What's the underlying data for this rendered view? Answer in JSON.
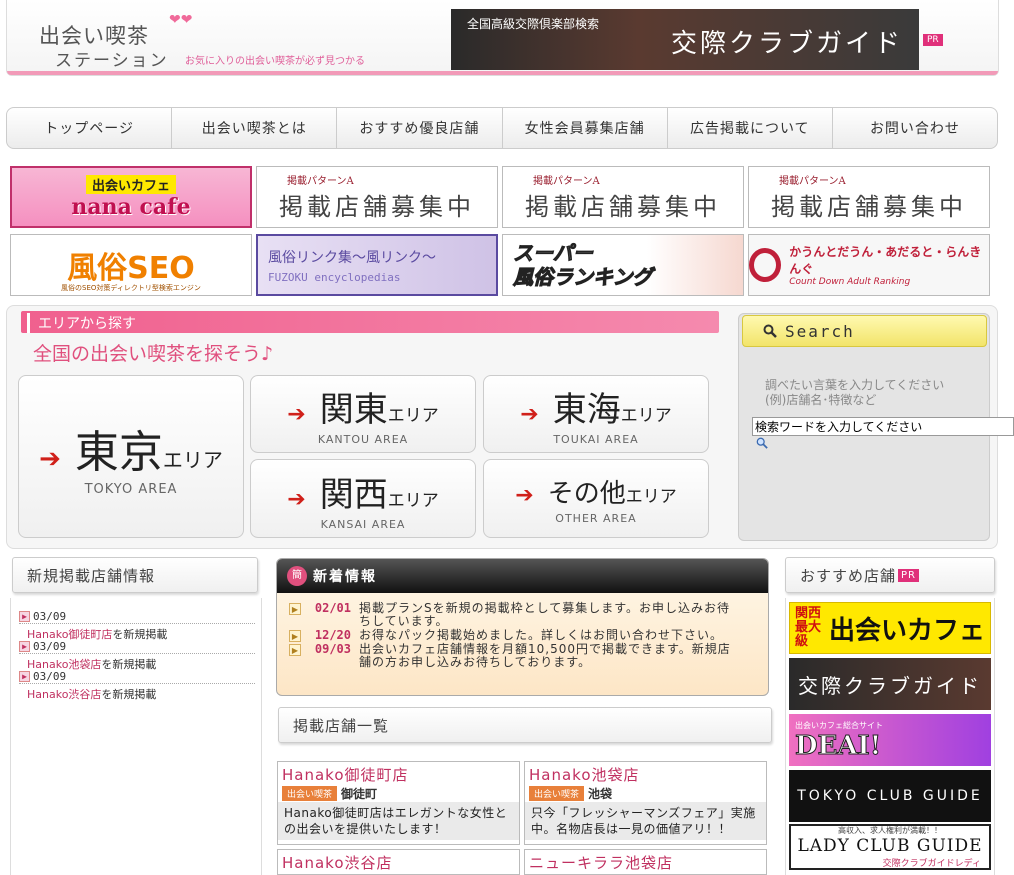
{
  "header": {
    "logo_main": "出会い喫茶",
    "logo_sub": "ステーション",
    "hearts": "❤❤",
    "tagline": "お気に入りの出会い喫茶が必ず見つかる",
    "banner_small": "全国高級交際倶楽部検索",
    "banner_big": "交際クラブガイド",
    "pr": "PR"
  },
  "nav": {
    "items": [
      "トップページ",
      "出会い喫茶とは",
      "おすすめ優良店舗",
      "女性会員募集店舗",
      "広告掲載について",
      "お問い合わせ"
    ]
  },
  "banners": {
    "nana_top": "出会いカフェ",
    "nana_bottom": "nana cafe",
    "ad_small": "掲載パターンA",
    "ad_big": "掲載店舗募集中",
    "seo_main": "風俗SEO",
    "seo_sub": "風俗のSEO対策ディレクトリ型検索エンジン",
    "link_jp": "風俗リンク集～風リンク～",
    "link_en": "FUZOKU encyclopedias",
    "super_1": "スーパー",
    "super_2": "風俗ランキング",
    "cd_jp": "かうんとだうん・あだると・らんきんぐ",
    "cd_en": "Count Down Adult Ranking"
  },
  "area": {
    "bar_label": "エリアから探す",
    "heading": "全国の出会い喫茶を探そう♪",
    "arrow": "➔",
    "suffix": "エリア",
    "tokyo": {
      "name": "東京",
      "en": "TOKYO AREA"
    },
    "kantou": {
      "name": "関東",
      "en": "KANTOU AREA"
    },
    "toukai": {
      "name": "東海",
      "en": "TOUKAI AREA"
    },
    "kansai": {
      "name": "関西",
      "en": "KANSAI AREA"
    },
    "other": {
      "name": "その他",
      "en": "OTHER AREA"
    }
  },
  "search": {
    "title": "Search",
    "hint_1": "調べたい言葉を入力してください",
    "hint_2": "(例)店舗名･特徴など",
    "input_value": "検索ワードを入力してください"
  },
  "new_stores": {
    "title": "新規掲載店舗情報",
    "items": [
      {
        "date": "03/09",
        "store": "Hanako御徒町店",
        "suffix": "を新規掲載"
      },
      {
        "date": "03/09",
        "store": "Hanako池袋店",
        "suffix": "を新規掲載"
      },
      {
        "date": "03/09",
        "store": "Hanako渋谷店",
        "suffix": "を新規掲載"
      }
    ]
  },
  "news": {
    "icon": "簡",
    "title": "新着情報",
    "items": [
      {
        "date": "02/01",
        "text": "掲載プランSを新規の掲載枠として募集します。お申し込みお待ちしています。"
      },
      {
        "date": "12/20",
        "text": "お得なパック掲載始めました。詳しくはお問い合わせ下さい。"
      },
      {
        "date": "09/03",
        "text": "出会いカフェ店舗情報を月額10,500円で掲載できます。新規店舗の方お申し込みお待ちしております。"
      }
    ]
  },
  "store_list": {
    "title": "掲載店舗一覧",
    "category": "出会い喫茶",
    "stores": [
      {
        "name": "Hanako御徒町店",
        "location": "御徒町",
        "desc": "Hanako御徒町店はエレガントな女性との出会いを提供いたします！"
      },
      {
        "name": "Hanako池袋店",
        "location": "池袋",
        "desc": "只今「フレッシャーマンズフェア」実施中。名物店長は一見の価値アリ！！"
      },
      {
        "name": "Hanako渋谷店",
        "location": "",
        "desc": ""
      },
      {
        "name": "ニューキララ池袋店",
        "location": "",
        "desc": ""
      }
    ]
  },
  "recommended": {
    "title": "おすすめ店舗",
    "pr": "PR",
    "b1_small": "関西最大級",
    "b1_big": "出会いカフェ",
    "b2": "交際クラブガイド",
    "b3_small": "出会いカフェ総合サイト",
    "b3_big": "DEAI!",
    "b4": "TOKYO CLUB GUIDE",
    "b5_small": "高収入、求人権利が満載！！",
    "b5_big": "LADY CLUB GUIDE",
    "b5_jp": "交際クラブガイドレディ"
  },
  "colors": {
    "pink": "#f0608e",
    "pink_text": "#c03060",
    "arrow_red": "#d0201a"
  }
}
